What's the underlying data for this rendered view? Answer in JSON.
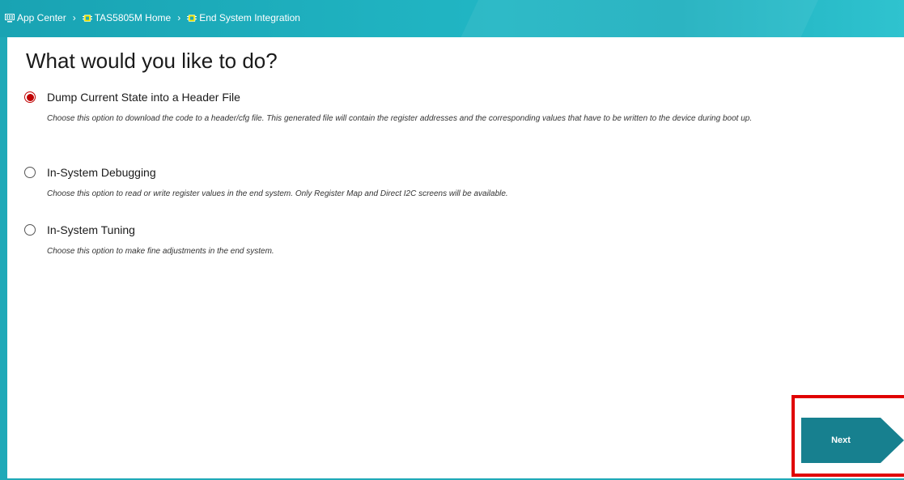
{
  "breadcrumb": {
    "items": [
      {
        "label": "App Center",
        "icon": "app-center-icon"
      },
      {
        "label": "TAS5805M Home",
        "icon": "chip-icon"
      },
      {
        "label": "End System Integration",
        "icon": "chip-icon"
      }
    ],
    "separator": "›"
  },
  "page": {
    "title": "What would you like to do?"
  },
  "options": [
    {
      "label": "Dump Current State into a Header File",
      "description": "Choose this option to download the code to a header/cfg file. This generated file will contain the register addresses and the corresponding values that have to be written to the device during boot up.",
      "selected": true
    },
    {
      "label": "In-System Debugging",
      "description": "Choose this option to read or write register values in the end system. Only Register Map and Direct I2C screens will be available.",
      "selected": false
    },
    {
      "label": "In-System Tuning",
      "description": "Choose this option to make fine adjustments in the end system.",
      "selected": false
    }
  ],
  "actions": {
    "next_label": "Next"
  },
  "colors": {
    "accent": "#1fa9b8",
    "button": "#17808f",
    "radio_selected": "#c00000",
    "highlight": "#e00000"
  }
}
